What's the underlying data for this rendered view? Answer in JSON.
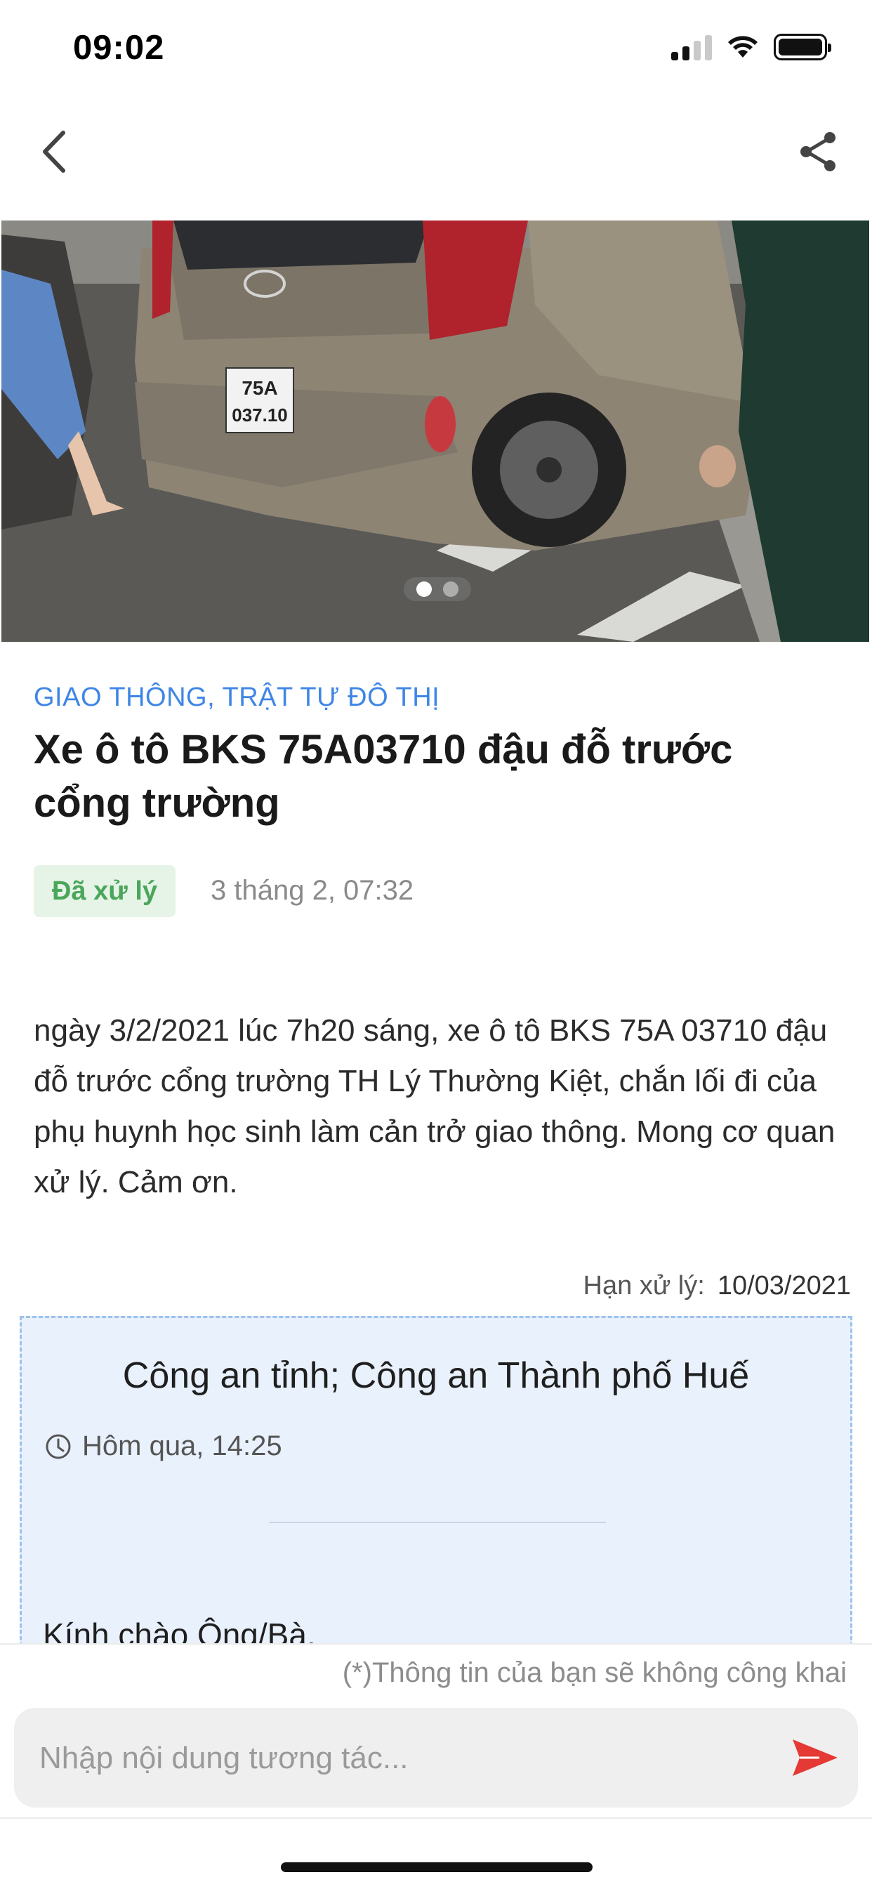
{
  "status_bar": {
    "time": "09:02",
    "icons": [
      "signal-icon",
      "wifi-icon",
      "battery-icon"
    ]
  },
  "nav": {
    "back_icon": "chevron-left-icon",
    "share_icon": "share-icon"
  },
  "gallery": {
    "page_count": 2,
    "active_index": 0
  },
  "report": {
    "category": "GIAO THÔNG, TRẬT TỰ ĐÔ THỊ",
    "title": "Xe ô tô BKS 75A03710 đậu đỗ trước cổng trường",
    "status_badge": "Đã xử lý",
    "date": "3 tháng 2, 07:32",
    "body": "ngày 3/2/2021 lúc 7h20 sáng, xe ô tô BKS 75A 03710 đậu đỗ trước cổng trường TH Lý Thường Kiệt, chắn lối đi của phụ huynh học sinh làm cản trở giao thông. Mong cơ quan xử lý. Cảm ơn.",
    "deadline_label": "Hạn xử lý:",
    "deadline_value": "10/03/2021"
  },
  "response": {
    "agency": "Công an tỉnh; Công an Thành phố Huế",
    "time": "Hôm qua, 14:25",
    "greeting": "Kính chào Ông/Bà,"
  },
  "composer": {
    "privacy_note": "(*)Thông tin của bạn sẽ không công khai",
    "placeholder": "Nhập nội dung tương tác...",
    "send_icon": "send-icon"
  },
  "colors": {
    "category": "#3e86e6",
    "badge_bg": "#e6f4e7",
    "badge_text": "#4aa65a",
    "card_bg": "#e9f1fd",
    "send": "#e53935"
  }
}
